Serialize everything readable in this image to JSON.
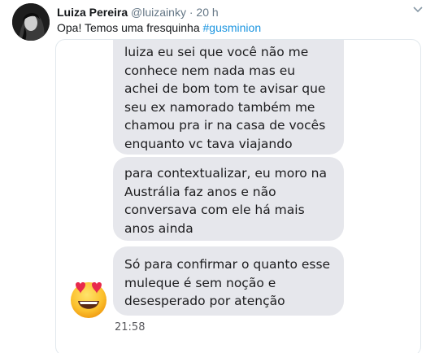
{
  "tweet": {
    "author_name": "Luiza Pereira",
    "handle": "@luizainky",
    "separator": "·",
    "time_ago": "20 h",
    "text": "Opa! Temos uma fresquinha",
    "hashtag": "#gusminion"
  },
  "chat": {
    "messages": [
      {
        "lines": [
          "luiza eu sei que você não me",
          "conhece nem nada mas eu",
          "achei de bom tom te avisar que",
          "seu ex namorado também me",
          "chamou pra ir na casa de vocês",
          "enquanto vc tava viajando"
        ]
      },
      {
        "lines": [
          "para contextualizar, eu moro na",
          "Austrália faz anos e não",
          "conversava com ele há mais",
          "anos ainda"
        ]
      },
      {
        "lines": [
          "Só para confirmar o quanto esse",
          "muleque é sem noção e",
          "desesperado por atenção"
        ]
      }
    ],
    "timestamp": "21:58",
    "emoji_icon": "heart-eyes-emoji-icon"
  },
  "colors": {
    "bubble": "#e6e7ec",
    "hashtag": "#1b95e0",
    "muted": "#657786"
  }
}
